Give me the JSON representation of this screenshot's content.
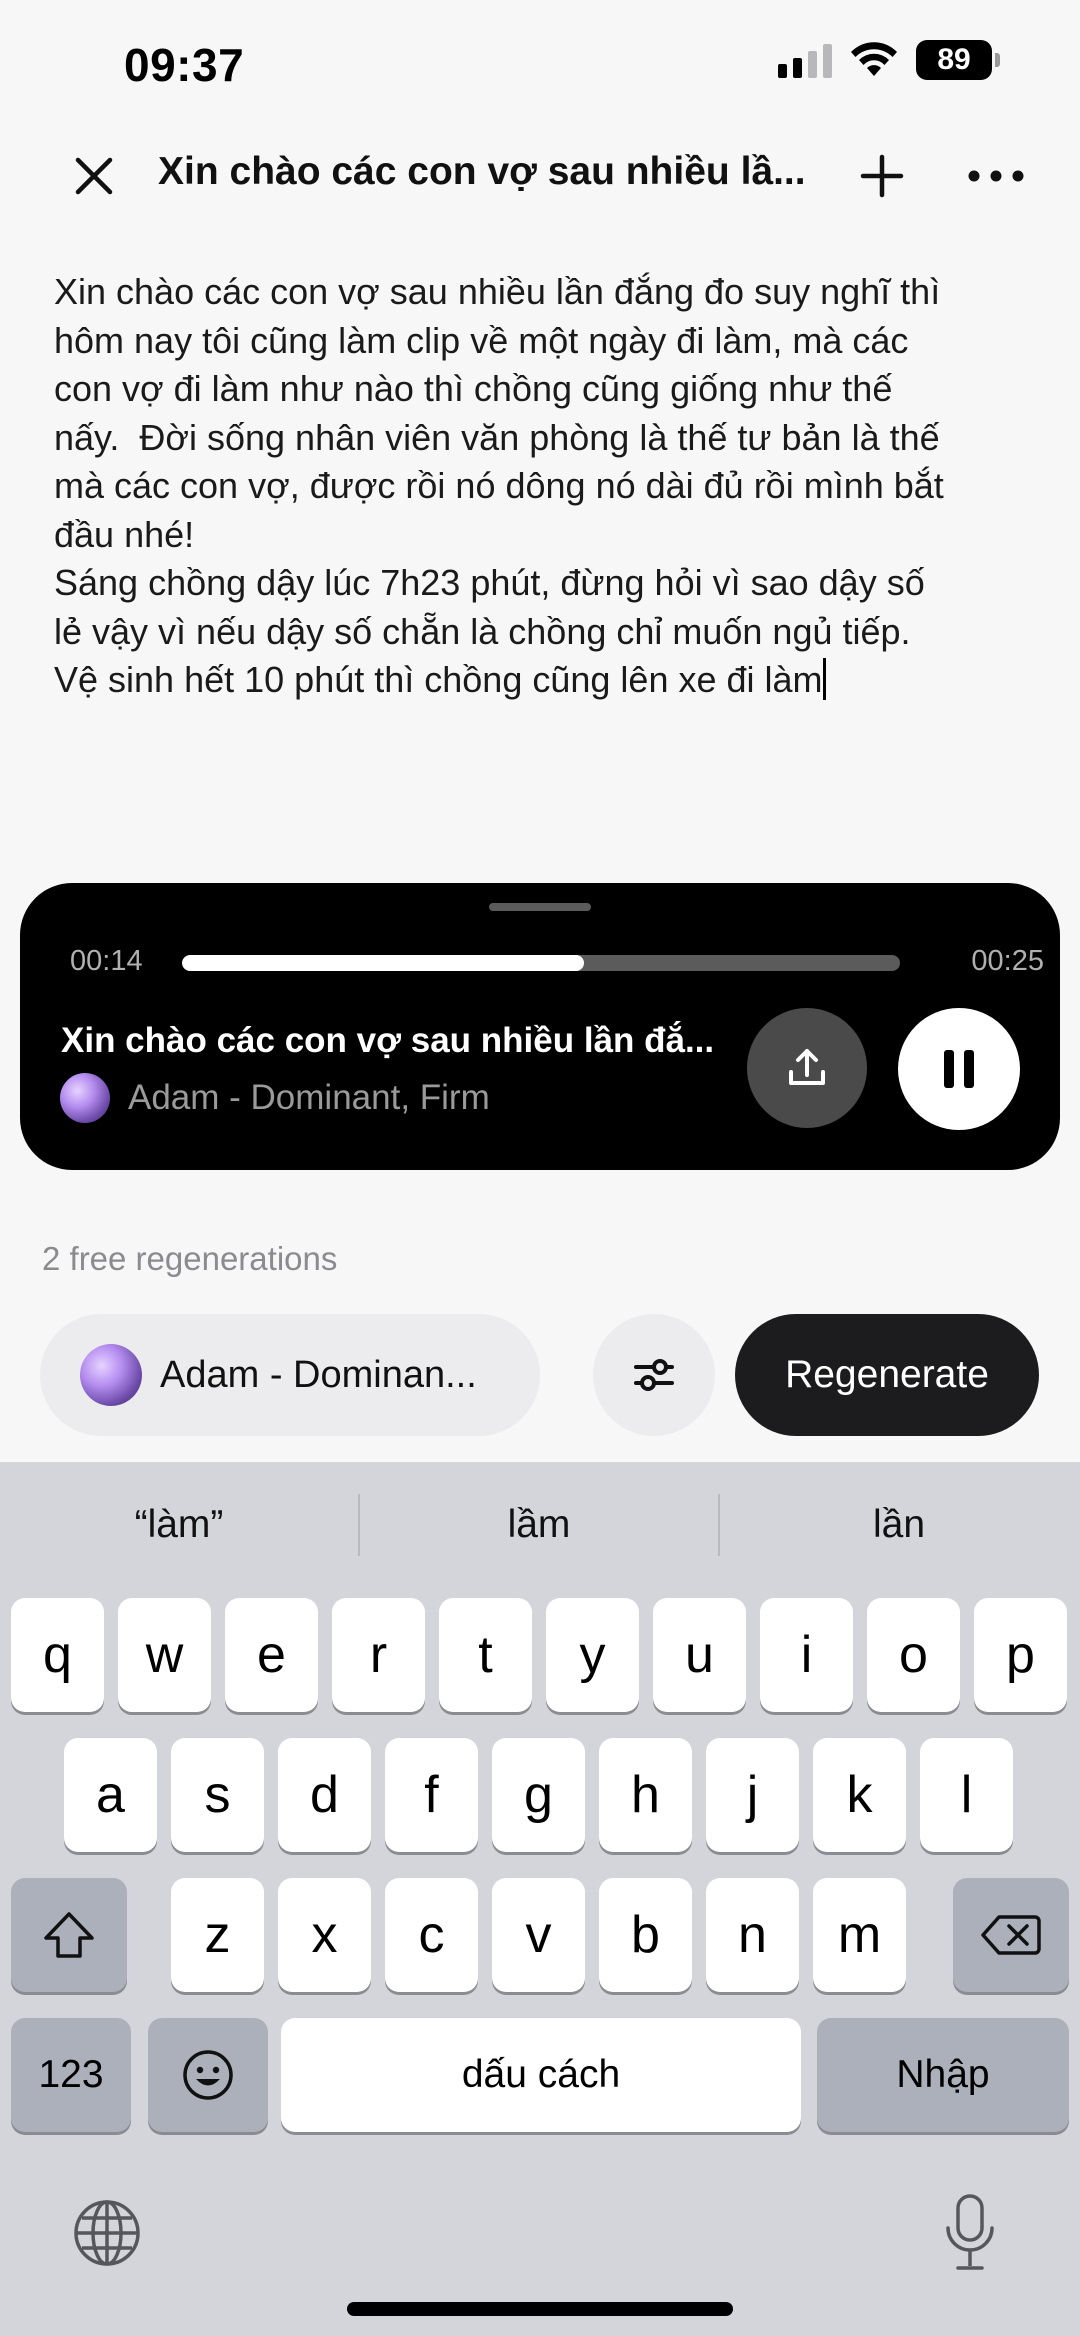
{
  "status_bar": {
    "time": "09:37",
    "battery": "89"
  },
  "header": {
    "title": "Xin chào các con vợ sau nhiều lầ..."
  },
  "editor": {
    "text": "Xin chào các con vợ sau nhiều lần đắng đo suy nghĩ thì\nhôm nay tôi cũng làm clip về một ngày đi làm, mà các\ncon vợ đi làm như nào thì chồng cũng giống như thế\nnấy.  Đời sống nhân viên văn phòng là thế tư bản là thế\nmà các con vợ, được rồi nó dông nó dài đủ rồi mình bắt\nđầu nhé!\nSáng chồng dậy lúc 7h23 phút, đừng hỏi vì sao dậy số\nlẻ vậy vì nếu dậy số chẵn là chồng chỉ muốn ngủ tiếp.\nVệ sinh hết 10 phút thì chồng cũng lên xe đi làm"
  },
  "player": {
    "current_time": "00:14",
    "total_time": "00:25",
    "progress_fraction": 0.56,
    "title": "Xin chào các con vợ sau nhiều lần đắ...",
    "voice_name": "Adam - Dominant, Firm"
  },
  "regen": {
    "free_label": "2 free regenerations",
    "voice_chip_label": "Adam - Dominan...",
    "regenerate_label": "Regenerate"
  },
  "keyboard": {
    "suggestions": [
      "“làm”",
      "lầm",
      "lần"
    ],
    "row1": [
      "q",
      "w",
      "e",
      "r",
      "t",
      "y",
      "u",
      "i",
      "o",
      "p"
    ],
    "row2": [
      "a",
      "s",
      "d",
      "f",
      "g",
      "h",
      "j",
      "k",
      "l"
    ],
    "row3": [
      "z",
      "x",
      "c",
      "v",
      "b",
      "n",
      "m"
    ],
    "numbers_key": "123",
    "space_key": "dấu cách",
    "return_key": "Nhập"
  },
  "colors": {
    "accent": "#1c1c1e",
    "player_bg": "#000000",
    "keyboard_bg": "#d3d5db"
  }
}
